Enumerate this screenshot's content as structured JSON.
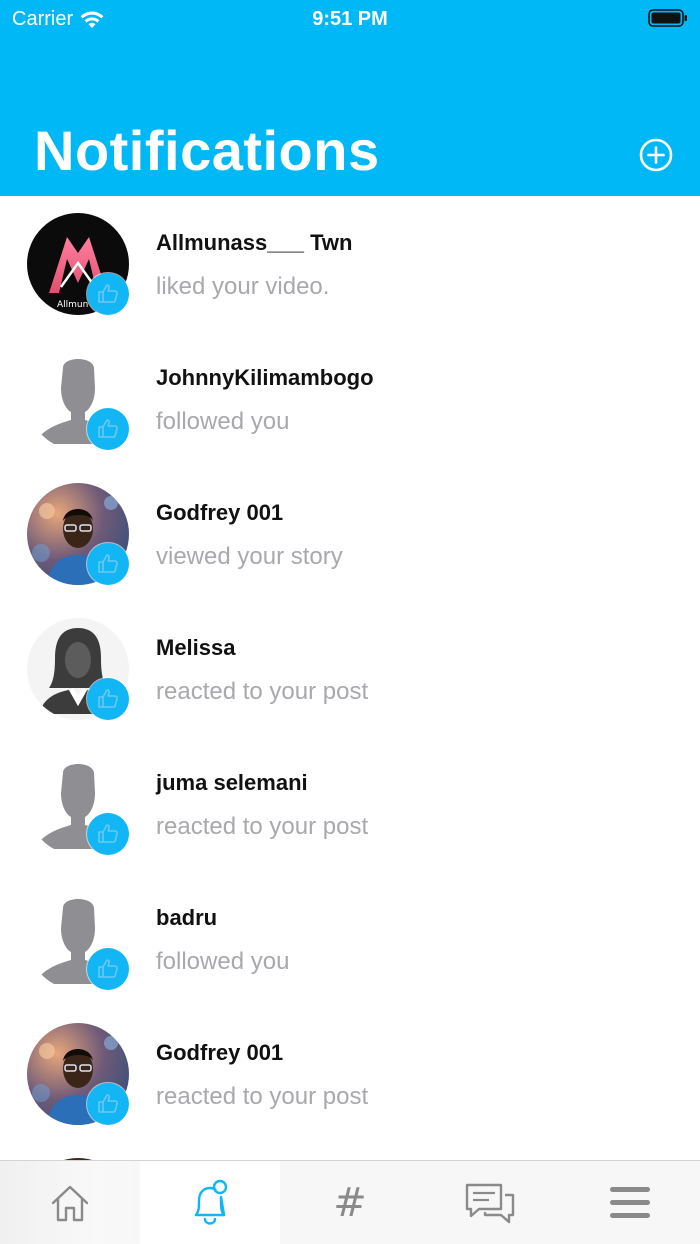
{
  "status_bar": {
    "carrier": "Carrier",
    "time": "9:51 PM"
  },
  "header": {
    "title": "Notifications",
    "add_icon": "plus-circle-icon"
  },
  "notifications": [
    {
      "user": "Allmunass___ Twn",
      "action": "liked your video.",
      "avatar": "brand-logo",
      "badge_icon": "thumbs-up-icon"
    },
    {
      "user": "JohnnyKilimambogo",
      "action": "followed you",
      "avatar": "default-male",
      "badge_icon": "thumbs-up-icon"
    },
    {
      "user": "Godfrey 001",
      "action": "viewed your story",
      "avatar": "photo",
      "badge_icon": "thumbs-up-icon"
    },
    {
      "user": "Melissa",
      "action": "reacted to your post",
      "avatar": "default-female",
      "badge_icon": "thumbs-up-icon"
    },
    {
      "user": "juma selemani",
      "action": "reacted to your post",
      "avatar": "default-male",
      "badge_icon": "thumbs-up-icon"
    },
    {
      "user": "badru",
      "action": "followed you",
      "avatar": "default-male",
      "badge_icon": "thumbs-up-icon"
    },
    {
      "user": "Godfrey 001",
      "action": "reacted to your post",
      "avatar": "photo",
      "badge_icon": "thumbs-up-icon"
    }
  ],
  "tab_bar": {
    "tabs": [
      {
        "id": "home",
        "icon": "home-icon",
        "active": false
      },
      {
        "id": "notifications",
        "icon": "bell-icon",
        "active": true
      },
      {
        "id": "hashtag",
        "icon": "hashtag-icon",
        "glyph": "#",
        "active": false
      },
      {
        "id": "messages",
        "icon": "chat-icon",
        "active": false
      },
      {
        "id": "menu",
        "icon": "menu-icon",
        "active": false
      }
    ]
  },
  "colors": {
    "accent": "#00b8f5",
    "badge": "#12b6f5",
    "secondary_text": "#a8a8ad",
    "tab_inactive": "#8a8a8a"
  }
}
